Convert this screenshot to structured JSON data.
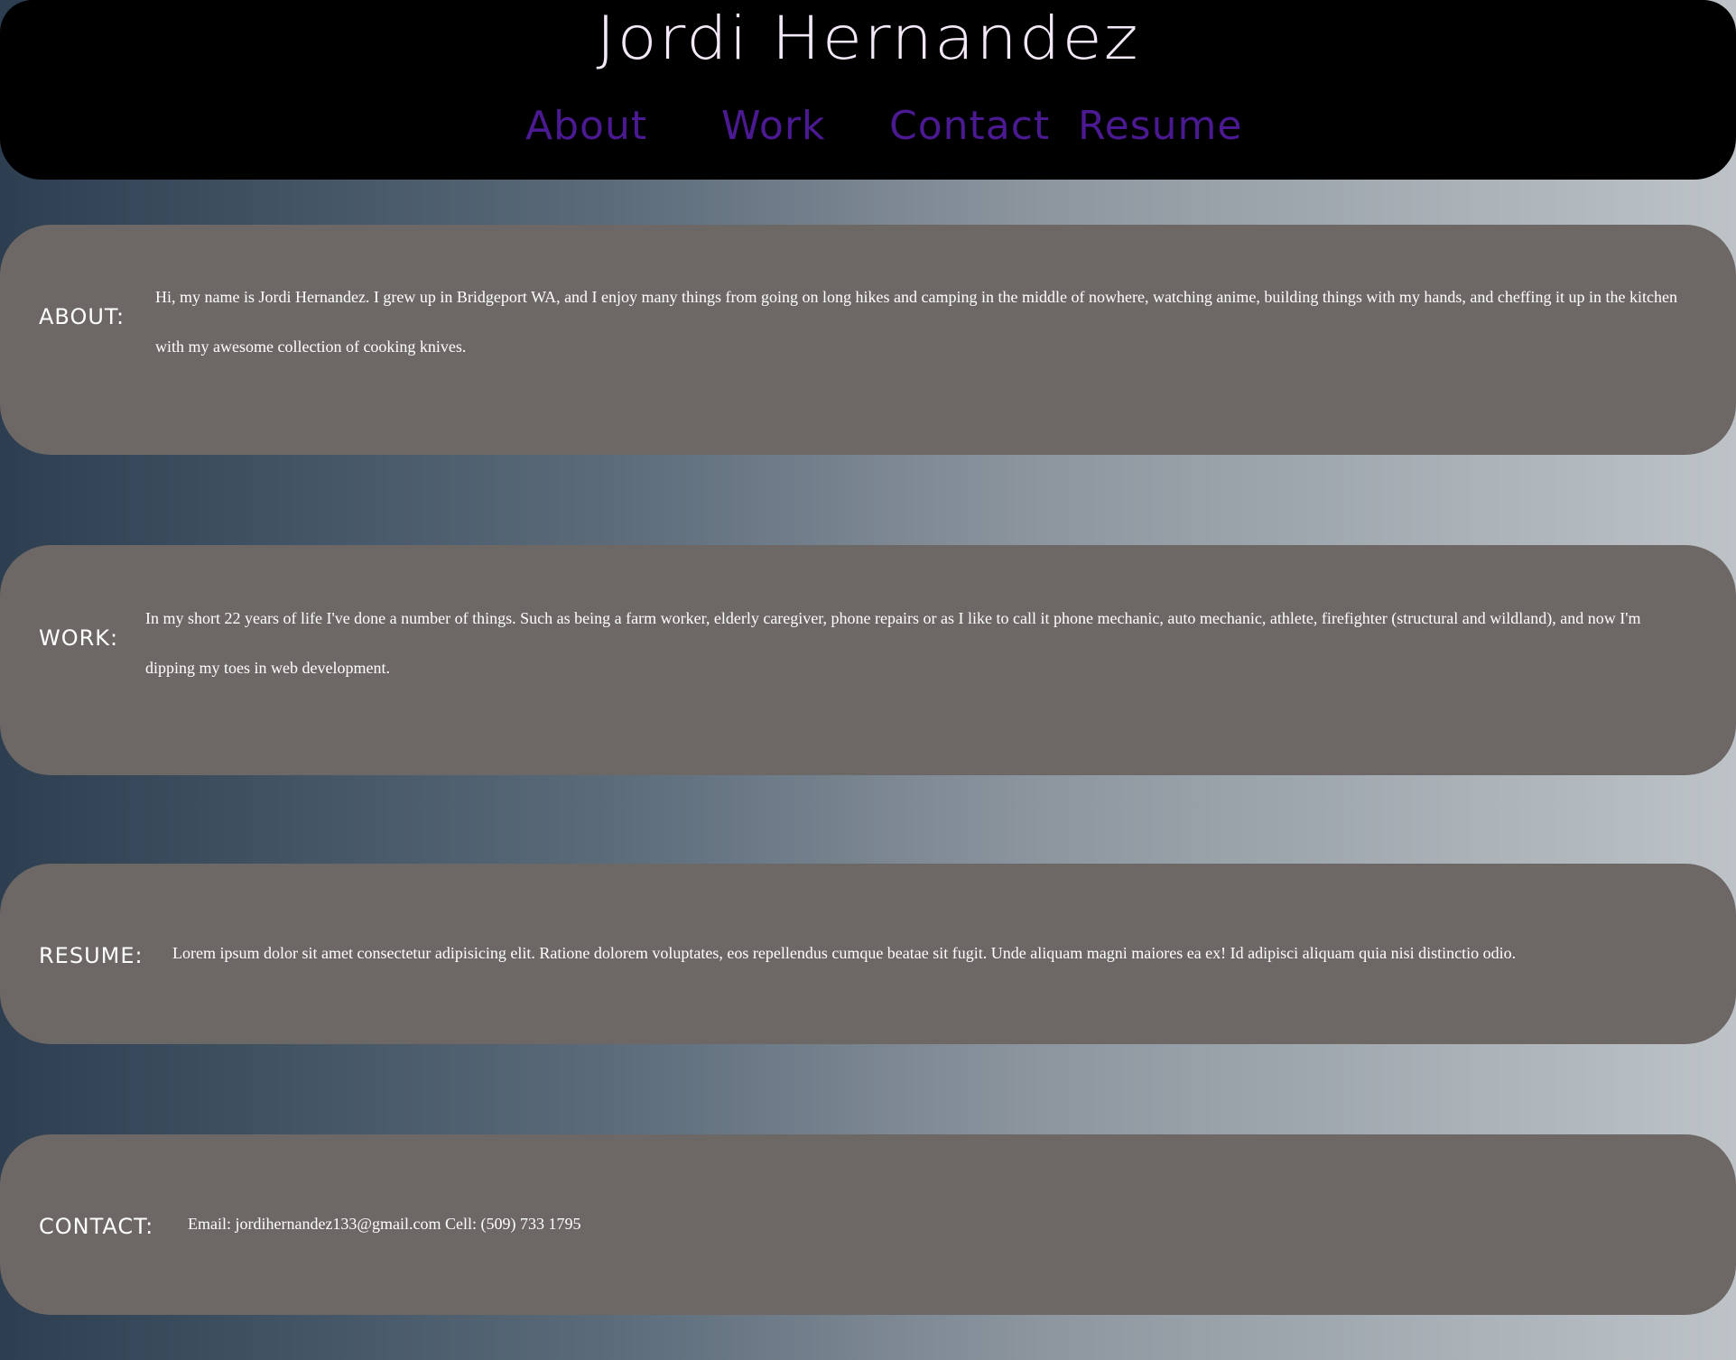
{
  "header": {
    "title": "Jordi Hernandez",
    "nav": [
      {
        "label": "About"
      },
      {
        "label": "Work"
      },
      {
        "label": "Contact"
      },
      {
        "label": "Resume"
      }
    ]
  },
  "sections": {
    "about": {
      "label": "ABOUT:",
      "text": "Hi, my name is Jordi Hernandez. I grew up in Bridgeport WA, and I enjoy many things from going on long hikes and camping in the middle of nowhere, watching anime, building things with my hands, and cheffing it up in the kitchen with my awesome collection of cooking knives."
    },
    "work": {
      "label": "WORK:",
      "text": "In my short 22 years of life I've done a number of things. Such as being a farm worker, elderly caregiver, phone repairs or as I like to call it phone mechanic, auto mechanic, athlete, firefighter (structural and wildland), and now I'm dipping my toes in web development."
    },
    "resume": {
      "label": "RESUME:",
      "text": "Lorem ipsum dolor sit amet consectetur adipisicing elit. Ratione dolorem voluptates, eos repellendus cumque beatae sit fugit. Unde aliquam magni maiores ea ex! Id adipisci aliquam quia nisi distinctio odio."
    },
    "contact": {
      "label": "CONTACT:",
      "text": "Email: jordihernandez133@gmail.com Cell: (509) 733 1795"
    }
  },
  "colors": {
    "header_bg": "#000000",
    "title": "#f2e8f7",
    "nav_link": "#4b1991",
    "card_bg": "#6d6866",
    "card_text": "#ffffff",
    "gradient_start": "#2c3e50",
    "gradient_end": "#bdc3c7"
  }
}
